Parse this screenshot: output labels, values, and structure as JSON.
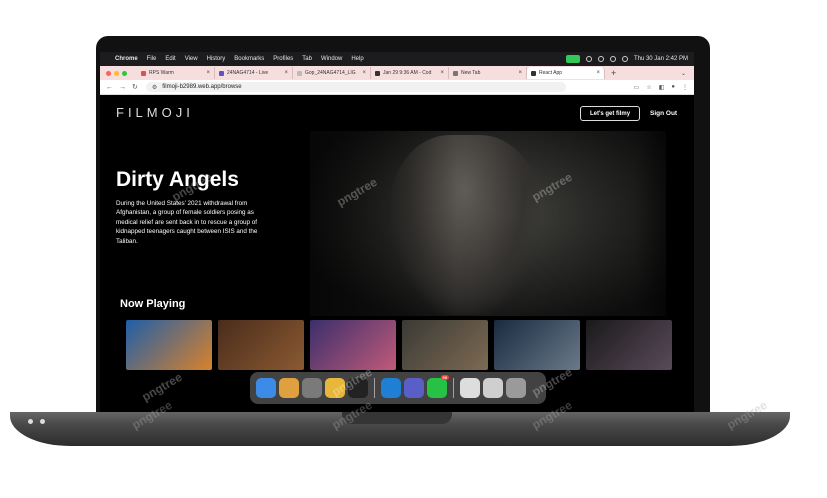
{
  "menubar": {
    "apple": "",
    "items": [
      "Chrome",
      "File",
      "Edit",
      "View",
      "History",
      "Bookmarks",
      "Profiles",
      "Tab",
      "Window",
      "Help"
    ],
    "clock": "Thu 30 Jan  2:42 PM"
  },
  "tabs": [
    {
      "title": "RPS Warm",
      "fav": "#d9534f"
    },
    {
      "title": "24NAG4714 - Live",
      "fav": "#5a55c8"
    },
    {
      "title": "Gop_24NAG4714_LIG",
      "fav": "#bbbbbb"
    },
    {
      "title": "Jan 29 9:36 AM - Cod",
      "fav": "#333333"
    },
    {
      "title": "New Tab",
      "fav": "#777777"
    },
    {
      "title": "React App",
      "fav": "#333333"
    }
  ],
  "address": {
    "url": "filmoji-b2989.web.app/browse"
  },
  "page": {
    "logo": "FILMOJI",
    "cta": "Let's get filmy",
    "signout": "Sign Out",
    "movie": {
      "title": "Dirty Angels",
      "description": "During the United States' 2021 withdrawal from Afghanistan, a group of female soldiers posing as medical relief are sent back in to rescue a group of kidnapped teenagers caught between ISIS and the Taliban."
    },
    "row_title": "Now Playing"
  },
  "posters": [
    {
      "name": "sonic",
      "colors": [
        "#1e5fa8",
        "#d9822b"
      ],
      "label": ""
    },
    {
      "name": "gladiator",
      "colors": [
        "#4a2c1c",
        "#8a5a32"
      ],
      "label": ""
    },
    {
      "name": "moana",
      "colors": [
        "#3b2f6b",
        "#c05a7a"
      ],
      "label": ""
    },
    {
      "name": "action-cast",
      "colors": [
        "#3a3a36",
        "#7d6a52"
      ],
      "label": ""
    },
    {
      "name": "nosferatu",
      "colors": [
        "#1a2a40",
        "#6a7a8a"
      ],
      "label": ""
    },
    {
      "name": "wolf",
      "colors": [
        "#1a1a1a",
        "#5a4a5a"
      ],
      "label": ""
    }
  ],
  "dock": [
    {
      "name": "finder",
      "color": "#3c8ce7"
    },
    {
      "name": "launchpad",
      "color": "#e0a040"
    },
    {
      "name": "settings",
      "color": "#7a7a7a"
    },
    {
      "name": "chrome",
      "color": "#e8b73a"
    },
    {
      "name": "terminal",
      "color": "#222222"
    },
    {
      "name": "vscode",
      "color": "#1f7fd4"
    },
    {
      "name": "teams",
      "color": "#5a5fc8"
    },
    {
      "name": "whatsapp",
      "color": "#25c245",
      "badge": "99"
    },
    {
      "name": "preview",
      "color": "#dddddd"
    },
    {
      "name": "downloads",
      "color": "#cfcfcf"
    },
    {
      "name": "trash",
      "color": "#9a9a9a"
    }
  ],
  "watermark": "pngtree"
}
